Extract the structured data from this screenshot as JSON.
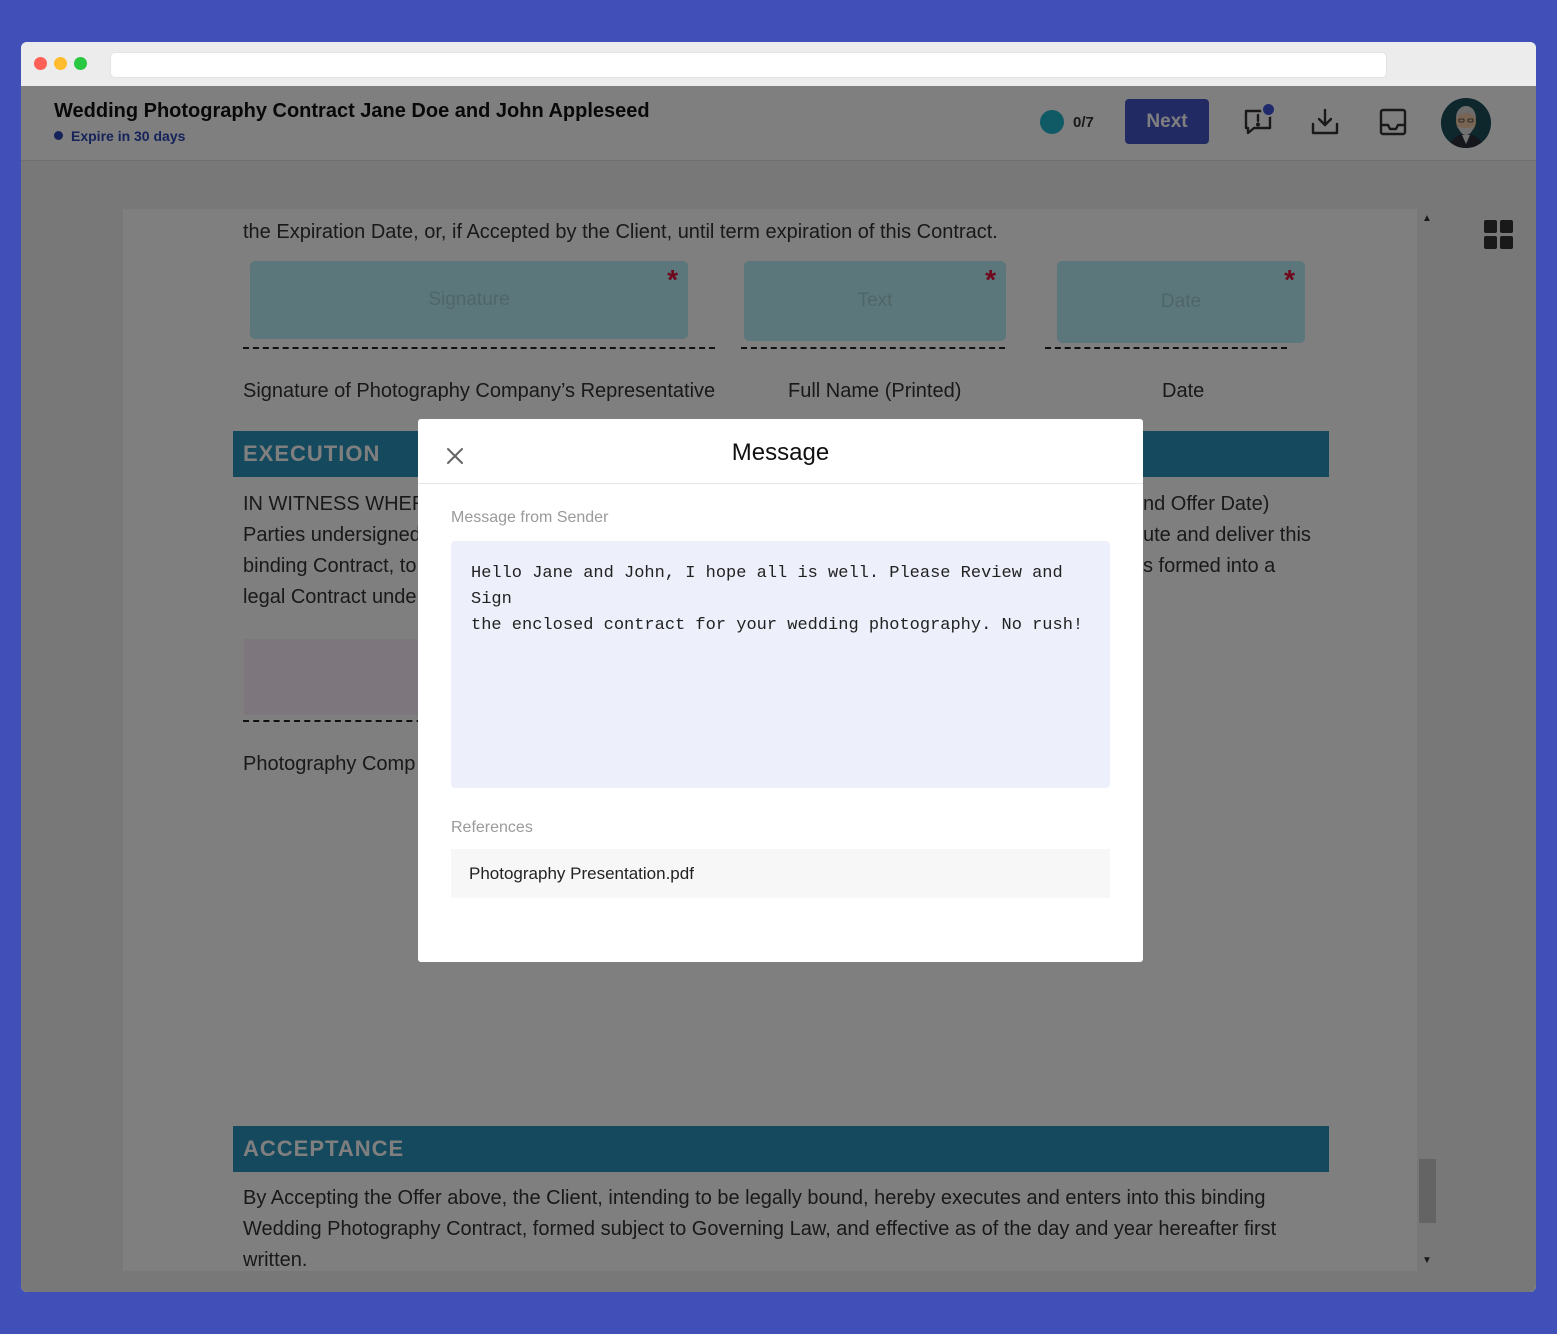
{
  "header": {
    "doc_title": "Wedding Photography Contract Jane Doe and John Appleseed",
    "expire": "Expire in 30 days",
    "progress": "0/7",
    "next_label": "Next",
    "icons": [
      "message-alert-icon",
      "download-icon",
      "inbox-icon",
      "avatar"
    ]
  },
  "document": {
    "line_expiration": "the Expiration Date, or, if Accepted by the Client, until term expiration of this Contract.",
    "fields": {
      "signature": "Signature",
      "text": "Text",
      "date": "Date",
      "required_mark": "*"
    },
    "caption_signature": "Signature of Photography Company’s Representative",
    "caption_fullname": "Full Name (Printed)",
    "caption_date": "Date",
    "execution_title": "EXECUTION",
    "execution_left": [
      "IN WITNESS WHERE",
      "Parties undersigned",
      "binding Contract, to",
      "legal Contract unde"
    ],
    "execution_right": [
      "nd Offer Date)",
      "ute and deliver this",
      "s formed into a"
    ],
    "photography_company": "Photography Comp",
    "acceptance_title": "ACCEPTANCE",
    "acceptance_lines": [
      "By Accepting the Offer above, the Client, intending to be legally bound, hereby executes and enters into this binding",
      "Wedding Photography Contract, formed subject to Governing Law, and effective as of the day and year hereafter first",
      "written."
    ]
  },
  "modal": {
    "title": "Message",
    "sender_label": "Message from Sender",
    "message_lines": [
      "Hello Jane and John, I hope all is well. Please Review and Sign",
      "the enclosed contract for your wedding photography. No rush!"
    ],
    "references_label": "References",
    "reference_file": "Photography Presentation.pdf"
  },
  "colors": {
    "background": "#4150b8",
    "accent": "#4554c8",
    "section_bar": "#2b93bb",
    "field": "#b9eff6",
    "required": "#e0103a"
  }
}
